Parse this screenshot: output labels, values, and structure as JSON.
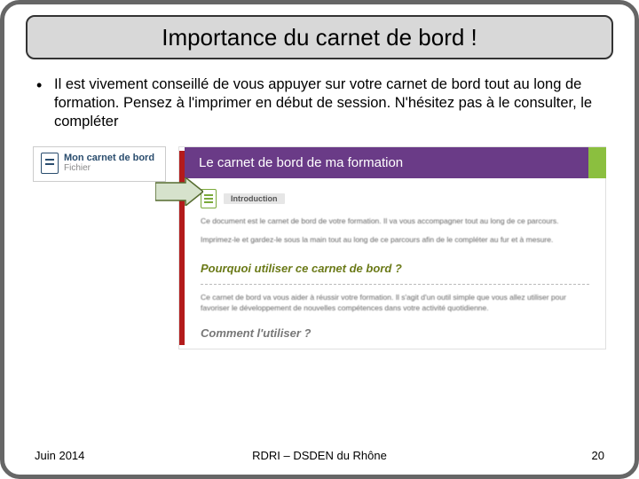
{
  "title": "Importance du carnet de bord !",
  "bullet": "Il est vivement conseillé de vous appuyer sur votre carnet de bord tout au long de formation. Pensez à l'imprimer en début de session. N'hésitez pas à le consulter, le compléter",
  "card": {
    "title": "Mon carnet de bord",
    "subtitle": "Fichier"
  },
  "pageshot": {
    "header": "Le carnet de bord de ma formation",
    "intro_label": "Introduction",
    "intro_p1": "Ce document est le carnet de bord de votre formation. Il va vous accompagner tout au long de ce parcours.",
    "intro_p2": "Imprimez-le et gardez-le sous la main tout au long de ce parcours afin de le compléter au fur et à mesure.",
    "q1": "Pourquoi utiliser ce carnet de bord ?",
    "q1_body": "Ce carnet de bord va vous aider à réussir votre formation. Il s'agit d'un outil simple que vous allez utiliser pour favoriser le développement de nouvelles compétences dans votre activité quotidienne.",
    "q2": "Comment l'utiliser ?"
  },
  "footer": {
    "left": "Juin 2014",
    "center": "RDRI – DSDEN du Rhône",
    "right": "20"
  }
}
